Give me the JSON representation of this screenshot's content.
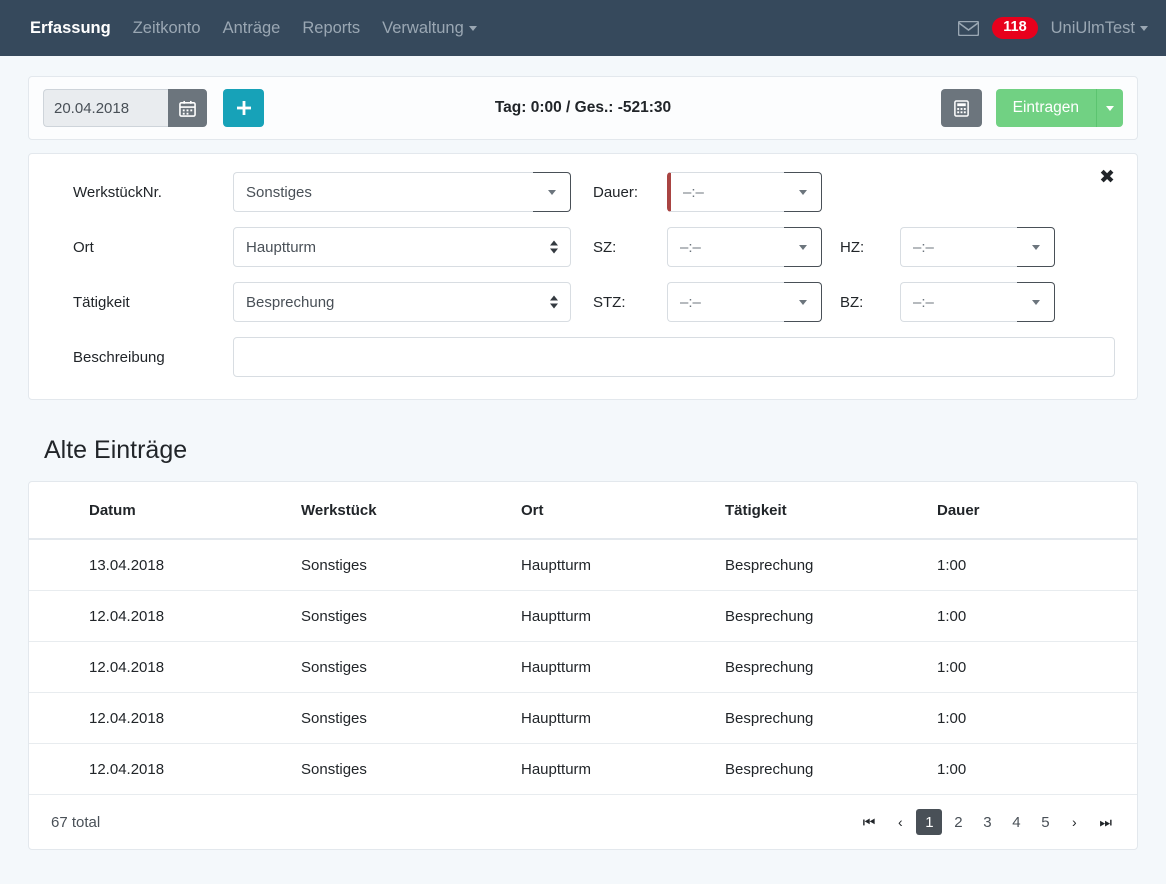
{
  "navbar": {
    "links": [
      {
        "label": "Erfassung",
        "active": true
      },
      {
        "label": "Zeitkonto",
        "active": false
      },
      {
        "label": "Anträge",
        "active": false
      },
      {
        "label": "Reports",
        "active": false
      },
      {
        "label": "Verwaltung",
        "active": false,
        "dropdown": true
      }
    ],
    "mail_icon": "envelope-icon",
    "badge_count": "118",
    "user": "UniUlmTest",
    "background_color": "#36495c",
    "badge_color": "#e8001c"
  },
  "toolbar": {
    "date_value": "20.04.2018",
    "calendar_icon": "calendar-icon",
    "add_icon": "plus-icon",
    "summary": "Tag: 0:00 / Ges.: -521:30",
    "calculator_icon": "calculator-icon",
    "submit_label": "Eintragen",
    "submit_caret_icon": "chevron-down-icon",
    "submit_color": "#71d183",
    "add_color": "#17a2b8"
  },
  "form": {
    "close_icon": "close-icon",
    "werkstueck": {
      "label": "WerkstückNr.",
      "value": "Sonstiges",
      "toggle_icon": "chevron-down-icon"
    },
    "ort": {
      "label": "Ort",
      "value": "Hauptturm",
      "options": [
        "Hauptturm"
      ]
    },
    "taetigkeit": {
      "label": "Tätigkeit",
      "value": "Besprechung",
      "options": [
        "Besprechung"
      ]
    },
    "beschreibung": {
      "label": "Beschreibung",
      "value": ""
    },
    "dauer": {
      "label": "Dauer:",
      "placeholder": "–:–",
      "value": "",
      "invalid": true,
      "toggle_icon": "chevron-down-icon"
    },
    "sz": {
      "label": "SZ:",
      "placeholder": "–:–",
      "value": "",
      "toggle_icon": "chevron-down-icon"
    },
    "hz": {
      "label": "HZ:",
      "placeholder": "–:–",
      "value": "",
      "toggle_icon": "chevron-down-icon"
    },
    "stz": {
      "label": "STZ:",
      "placeholder": "–:–",
      "value": "",
      "toggle_icon": "chevron-down-icon"
    },
    "bz": {
      "label": "BZ:",
      "placeholder": "–:–",
      "value": "",
      "toggle_icon": "chevron-down-icon"
    }
  },
  "table": {
    "title": "Alte Einträge",
    "headers": [
      "Datum",
      "Werkstück",
      "Ort",
      "Tätigkeit",
      "Dauer"
    ],
    "rows": [
      {
        "datum": "13.04.2018",
        "werkstueck": "Sonstiges",
        "ort": "Hauptturm",
        "taetigkeit": "Besprechung",
        "dauer": "1:00"
      },
      {
        "datum": "12.04.2018",
        "werkstueck": "Sonstiges",
        "ort": "Hauptturm",
        "taetigkeit": "Besprechung",
        "dauer": "1:00"
      },
      {
        "datum": "12.04.2018",
        "werkstueck": "Sonstiges",
        "ort": "Hauptturm",
        "taetigkeit": "Besprechung",
        "dauer": "1:00"
      },
      {
        "datum": "12.04.2018",
        "werkstueck": "Sonstiges",
        "ort": "Hauptturm",
        "taetigkeit": "Besprechung",
        "dauer": "1:00"
      },
      {
        "datum": "12.04.2018",
        "werkstueck": "Sonstiges",
        "ort": "Hauptturm",
        "taetigkeit": "Besprechung",
        "dauer": "1:00"
      }
    ],
    "total": "67 total",
    "pagination": {
      "first_icon": "first-page-icon",
      "prev_icon": "prev-page-icon",
      "pages": [
        "1",
        "2",
        "3",
        "4",
        "5"
      ],
      "active_page": "1",
      "next_icon": "next-page-icon",
      "last_icon": "last-page-icon"
    }
  }
}
